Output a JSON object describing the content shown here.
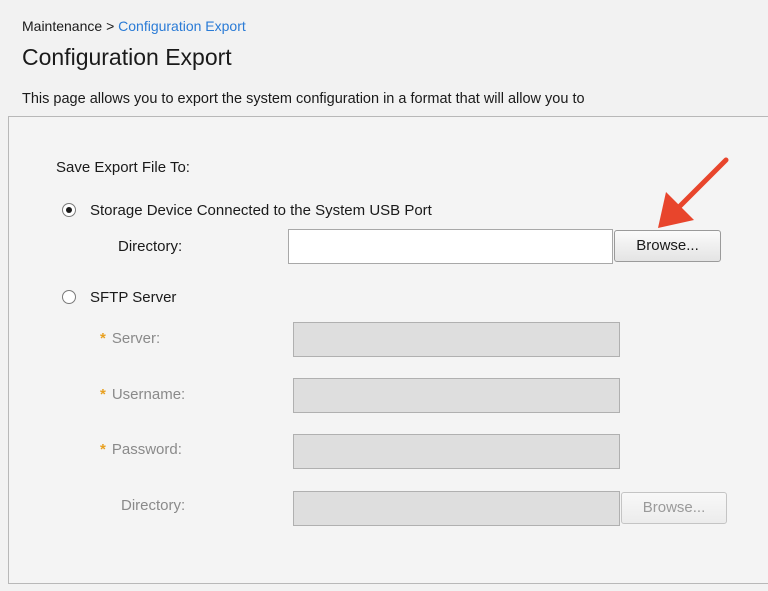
{
  "breadcrumb": {
    "parent": "Maintenance",
    "separator": ">",
    "current": "Configuration Export"
  },
  "page_title": "Configuration Export",
  "description": "This page allows you to export the system configuration in a format that will allow you to",
  "form": {
    "save_to_label": "Save Export File To:",
    "usb_option": {
      "label": "Storage Device Connected to the System USB Port",
      "selected": true,
      "directory_label": "Directory:",
      "directory_value": "",
      "browse_label": "Browse..."
    },
    "sftp_option": {
      "label": "SFTP Server",
      "selected": false,
      "required_marker": "*",
      "server_label": "Server:",
      "username_label": "Username:",
      "password_label": "Password:",
      "directory_label": "Directory:",
      "browse_label": "Browse..."
    }
  },
  "annotation": {
    "arrow_icon": "red-arrow-icon",
    "color": "#e8452c"
  },
  "colors": {
    "link": "#2a7bd6",
    "required": "#e8a020",
    "panel_bg": "#f4f4f4",
    "page_bg": "#f2f2f2"
  }
}
